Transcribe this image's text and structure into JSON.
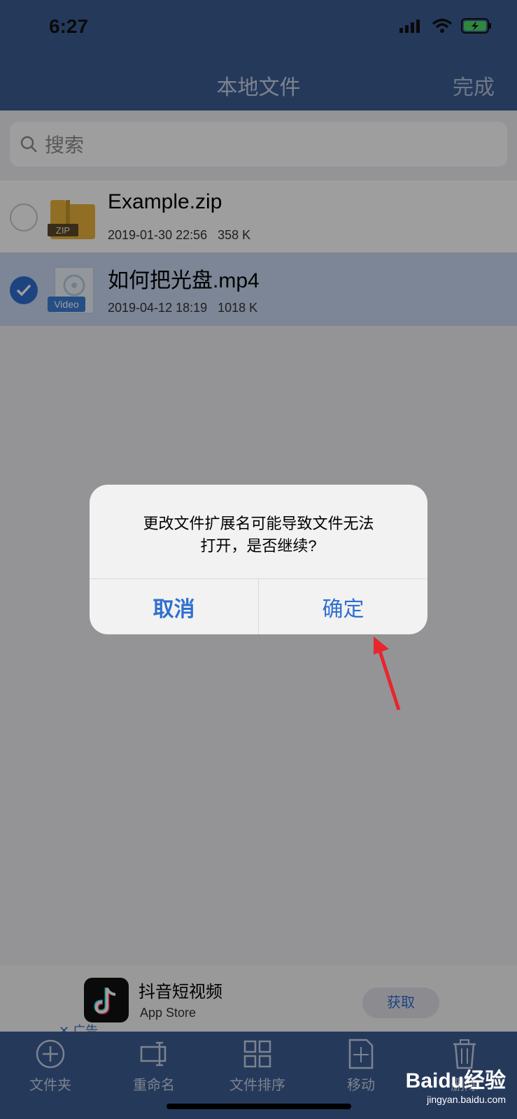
{
  "status": {
    "time": "6:27"
  },
  "nav": {
    "title": "本地文件",
    "done_label": "完成"
  },
  "search": {
    "placeholder": "搜索"
  },
  "files": [
    {
      "name": "Example.zip",
      "date": "2019-01-30 22:56",
      "size": "358 K",
      "icon": "zip-folder-icon",
      "icon_label": "ZIP",
      "selected": false
    },
    {
      "name": "如何把光盘.mp4",
      "date": "2019-04-12 18:19",
      "size": "1018 K",
      "icon": "video-file-icon",
      "icon_label": "Video",
      "selected": true
    }
  ],
  "dialog": {
    "message_line1": "更改文件扩展名可能导致文件无法",
    "message_line2": "打开，是否继续?",
    "cancel_label": "取消",
    "confirm_label": "确定"
  },
  "ad": {
    "title": "抖音短视频",
    "subtitle": "App Store",
    "close_label": "✕ 广告",
    "get_label": "获取"
  },
  "toolbar": {
    "items": [
      {
        "label": "文件夹",
        "icon": "add-folder-icon"
      },
      {
        "label": "重命名",
        "icon": "rename-icon"
      },
      {
        "label": "文件排序",
        "icon": "sort-grid-icon"
      },
      {
        "label": "移动",
        "icon": "move-icon"
      },
      {
        "label": "删除",
        "icon": "trash-icon"
      }
    ]
  },
  "watermark": {
    "main": "Baidu经验",
    "sub": "jingyan.baidu.com"
  },
  "colors": {
    "nav_bg": "#3c5d94",
    "accent": "#2f6fd0",
    "selected_row": "#c8d9f2",
    "annotation_arrow": "#e8262d"
  }
}
